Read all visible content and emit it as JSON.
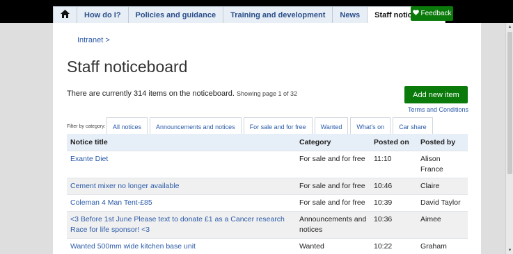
{
  "nav": {
    "home_icon": "home-icon",
    "items": [
      "How do I?",
      "Policies and guidance",
      "Training and development",
      "News",
      "Staff noticeboard"
    ],
    "active": "Staff noticeboard",
    "feedback_label": "Feedback",
    "feedback_icon": "heart-icon"
  },
  "breadcrumb": "Intranet >",
  "title": "Staff noticeboard",
  "summary": {
    "text": "There are currently 314 items on the noticeboard.",
    "page_info": "Showing page 1 of 32"
  },
  "add_button": "Add new item",
  "terms_link": "Terms and Conditions",
  "filter": {
    "label": "Filter by category:",
    "tabs": [
      "All notices",
      "Announcements and notices",
      "For sale and for free",
      "Wanted",
      "What's on",
      "Car share"
    ]
  },
  "table": {
    "headers": [
      "Notice title",
      "Category",
      "Posted on",
      "Posted by"
    ],
    "rows": [
      [
        "Exante Diet",
        "For sale and for free",
        "11:10",
        "Alison France"
      ],
      [
        "Cement mixer no longer available",
        "For sale and for free",
        "10:46",
        "Claire"
      ],
      [
        "Coleman 4 Man Tent-£85",
        "For sale and for free",
        "10:39",
        "David Taylor"
      ],
      [
        "<3 Before 1st June Please text to donate £1 as a Cancer research Race for life sponsor! <3",
        "Announcements and notices",
        "10:36",
        "Aimee"
      ],
      [
        "Wanted 500mm wide kitchen base unit",
        "Wanted",
        "10:22",
        "Graham Kesterton"
      ]
    ]
  },
  "colors": {
    "accent_green": "#0a7a0a",
    "link_blue": "#2a5aa8",
    "header_bg": "#e6eef7"
  }
}
